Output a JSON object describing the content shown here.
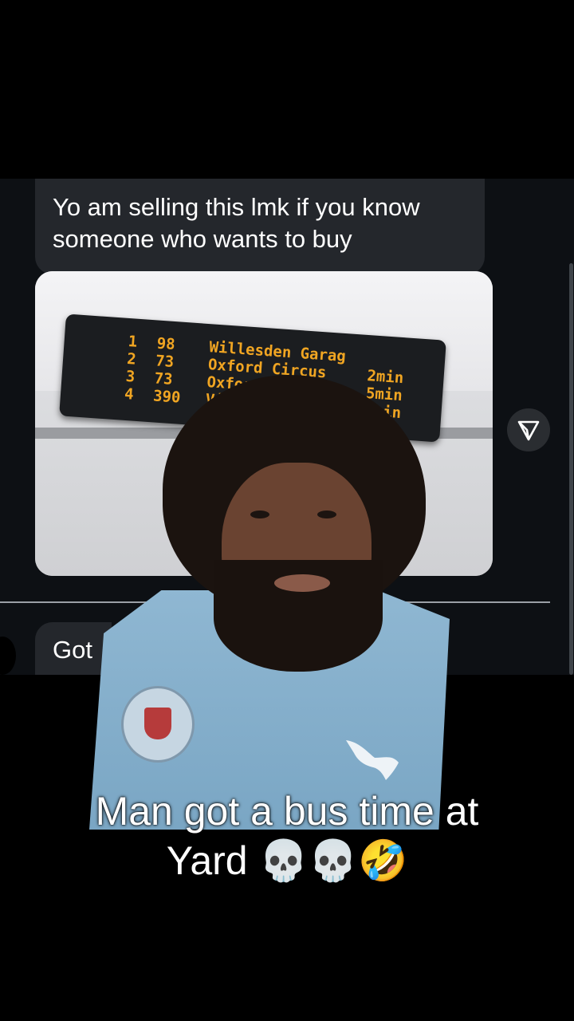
{
  "chat": {
    "message_top": "Yo am selling this lmk if you know someone who wants to buy",
    "message_bottom_partial": "Got",
    "send_icon": "send-paper-plane-icon"
  },
  "bus_board": {
    "rows": [
      {
        "num": "1",
        "route": "98",
        "destination": "Willesden Garag",
        "time": ""
      },
      {
        "num": "2",
        "route": "73",
        "destination": "Oxford Circus",
        "time": "2min"
      },
      {
        "num": "3",
        "route": "73",
        "destination": "Oxford",
        "time": "5min"
      },
      {
        "num": "4",
        "route": "390",
        "destination": "Vi",
        "time": "6min"
      }
    ],
    "color": "#f0a522"
  },
  "video": {
    "caption_line1": "Man got a bus time at",
    "caption_line2": "Yard 💀💀🤣"
  }
}
